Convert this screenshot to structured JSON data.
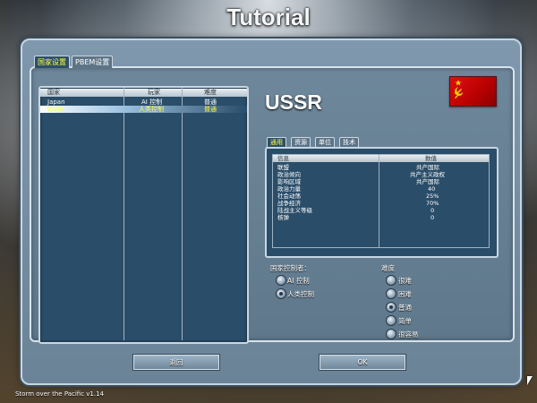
{
  "app": {
    "title": "Tutorial",
    "version_text": "Storm over the Pacific v1.14"
  },
  "tabs": [
    {
      "label": "国家设置",
      "active": true
    },
    {
      "label": "PBEM设置",
      "active": false
    }
  ],
  "country_list": {
    "headers": [
      "国家",
      "玩家",
      "难度"
    ],
    "rows": [
      {
        "country": "Japan",
        "player": "AI 控制",
        "difficulty": "普通",
        "selected": false
      },
      {
        "country": "USSR",
        "player": "人类控制",
        "difficulty": "普通",
        "selected": true
      }
    ]
  },
  "selected_country": {
    "name": "USSR",
    "flag_icon": "soviet-flag-icon",
    "flag_color": "#cc0000"
  },
  "detail_tabs": [
    {
      "label": "通用",
      "active": true
    },
    {
      "label": "资源",
      "active": false
    },
    {
      "label": "单位",
      "active": false
    },
    {
      "label": "技术",
      "active": false
    }
  ],
  "info_table": {
    "headers": [
      "信息",
      "数值"
    ],
    "rows": [
      {
        "key": "联盟",
        "value": "共产国际"
      },
      {
        "key": "政治倾向",
        "value": "共产主义政权"
      },
      {
        "key": "影响区域",
        "value": "共产国际"
      },
      {
        "key": "政治力量",
        "value": "40"
      },
      {
        "key": "社会动荡",
        "value": "25%"
      },
      {
        "key": "战争经济",
        "value": "70%"
      },
      {
        "key": "陆战主义等级",
        "value": "0"
      },
      {
        "key": "核弹",
        "value": "0"
      }
    ]
  },
  "controller": {
    "label": "国家控制者：",
    "options": [
      {
        "label": "AI 控制",
        "selected": false
      },
      {
        "label": "人类控制",
        "selected": true
      }
    ]
  },
  "difficulty": {
    "label": "难度",
    "options": [
      {
        "label": "很难",
        "selected": false
      },
      {
        "label": "困难",
        "selected": false
      },
      {
        "label": "普通",
        "selected": true
      },
      {
        "label": "简单",
        "selected": false
      },
      {
        "label": "很容易",
        "selected": false
      }
    ]
  },
  "buttons": {
    "back": "返回",
    "ok": "OK"
  },
  "colors": {
    "selected_tab_text": "#ffff44",
    "list_background": "#2a4d69",
    "accent_red": "#cc0000"
  }
}
